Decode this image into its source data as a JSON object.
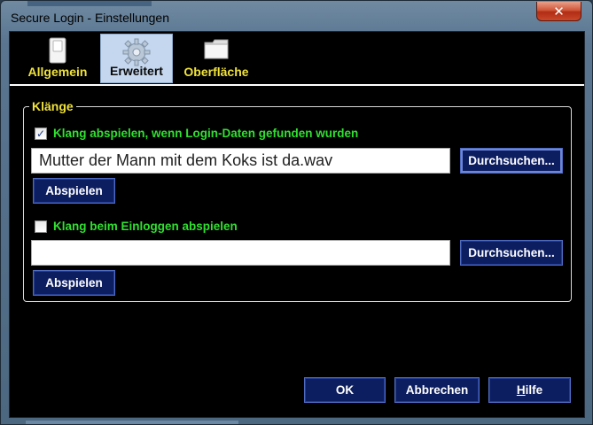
{
  "window": {
    "title": "Secure Login - Einstellungen",
    "close_glyph": "✕"
  },
  "tabs": [
    {
      "label": "Allgemein",
      "icon": "switch-icon",
      "active": false
    },
    {
      "label": "Erweitert",
      "icon": "gear-icon",
      "active": true
    },
    {
      "label": "Oberfläche",
      "icon": "folder-icon",
      "active": false
    }
  ],
  "sounds_group": {
    "title": "Klänge",
    "found": {
      "checkbox_label": "Klang abspielen, wenn Login-Daten gefunden wurden",
      "checked": true,
      "check_glyph": "✓",
      "file_value": "Mutter der Mann mit dem Koks ist da.wav",
      "browse_label": "Durchsuchen...",
      "play_label": "Abspielen"
    },
    "login": {
      "checkbox_label": "Klang beim Einloggen abspielen",
      "checked": false,
      "file_value": "",
      "browse_label": "Durchsuchen...",
      "play_label": "Abspielen"
    }
  },
  "footer": {
    "ok_label": "OK",
    "cancel_label": "Abbrechen",
    "help_label_prefix": "H",
    "help_label_rest": "ilfe"
  },
  "colors": {
    "tab_label": "#f0e23a",
    "checkbox_label": "#30e030",
    "button_bg": "#0d1e60"
  }
}
